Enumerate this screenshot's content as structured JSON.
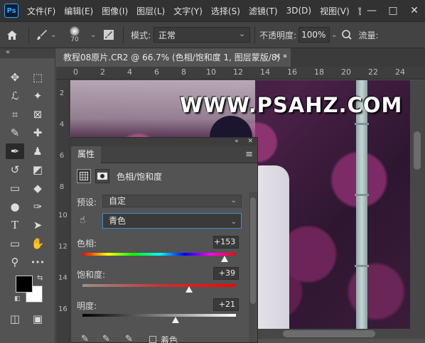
{
  "app": {
    "logo": "Ps",
    "menus": [
      "文件(F)",
      "编辑(E)",
      "图像(I)",
      "图层(L)",
      "文字(Y)",
      "选择(S)",
      "滤镜(T)",
      "3D(D)",
      "视图(V)",
      "窗"
    ],
    "window_controls": [
      "—",
      "□",
      "✕"
    ]
  },
  "options_bar": {
    "brush_size": "70",
    "mode_label": "模式:",
    "mode_value": "正常",
    "opacity_label": "不透明度:",
    "opacity_value": "100%",
    "flow_label": "流量:"
  },
  "toolbar": {
    "collapse": "«",
    "tools": [
      {
        "name": "move-tool-icon",
        "glyph": "✥"
      },
      {
        "name": "marquee-tool-icon",
        "glyph": "⬚"
      },
      {
        "name": "lasso-tool-icon",
        "glyph": "ℒ"
      },
      {
        "name": "magic-wand-icon",
        "glyph": "✦"
      },
      {
        "name": "crop-tool-icon",
        "glyph": "⌗"
      },
      {
        "name": "frame-tool-icon",
        "glyph": "⊠"
      },
      {
        "name": "eyedropper-tool-icon",
        "glyph": "✎"
      },
      {
        "name": "healing-brush-icon",
        "glyph": "✚"
      },
      {
        "name": "brush-tool-icon",
        "glyph": "✒"
      },
      {
        "name": "stamp-tool-icon",
        "glyph": "♟"
      },
      {
        "name": "history-brush-icon",
        "glyph": "↺"
      },
      {
        "name": "eraser-tool-icon",
        "glyph": "◩"
      },
      {
        "name": "gradient-tool-icon",
        "glyph": "▭"
      },
      {
        "name": "blur-tool-icon",
        "glyph": "◆"
      },
      {
        "name": "dodge-tool-icon",
        "glyph": "●"
      },
      {
        "name": "pen-tool-icon",
        "glyph": "✑"
      },
      {
        "name": "type-tool-icon",
        "glyph": "T"
      },
      {
        "name": "path-select-icon",
        "glyph": "➤"
      },
      {
        "name": "rectangle-tool-icon",
        "glyph": "▭"
      },
      {
        "name": "hand-tool-icon",
        "glyph": "✋"
      },
      {
        "name": "zoom-tool-icon",
        "glyph": "⚲"
      },
      {
        "name": "more-tools-icon",
        "glyph": "•••"
      },
      {
        "name": "quick-mask-icon",
        "glyph": "◫"
      },
      {
        "name": "screen-mode-icon",
        "glyph": "▣"
      }
    ]
  },
  "document": {
    "tab_title": "教程08原片.CR2 @ 66.7% (色相/饱和度 1, 图层蒙版/8) *",
    "close": "✕",
    "ruler_top": [
      "0",
      "2",
      "4",
      "6",
      "8",
      "10",
      "12",
      "14",
      "16",
      "18",
      "20",
      "22",
      "24"
    ],
    "ruler_left": [
      "2",
      "4",
      "6",
      "8",
      "10",
      "12",
      "14",
      "16"
    ],
    "watermark": "WWW.PSAHZ.COM"
  },
  "properties_panel": {
    "collapse": "«",
    "close": "✕",
    "tab_label": "属性",
    "menu": "≡",
    "adjustment_title": "色相/饱和度",
    "preset_label": "预设:",
    "preset_value": "自定",
    "channel_value": "青色",
    "hue_label": "色相:",
    "hue_value": "+153",
    "saturation_label": "饱和度:",
    "saturation_value": "+39",
    "lightness_label": "明度:",
    "lightness_value": "+21",
    "colorize_label": "着色",
    "hue_fraction": 0.925,
    "saturation_fraction": 0.695,
    "lightness_fraction": 0.605
  }
}
